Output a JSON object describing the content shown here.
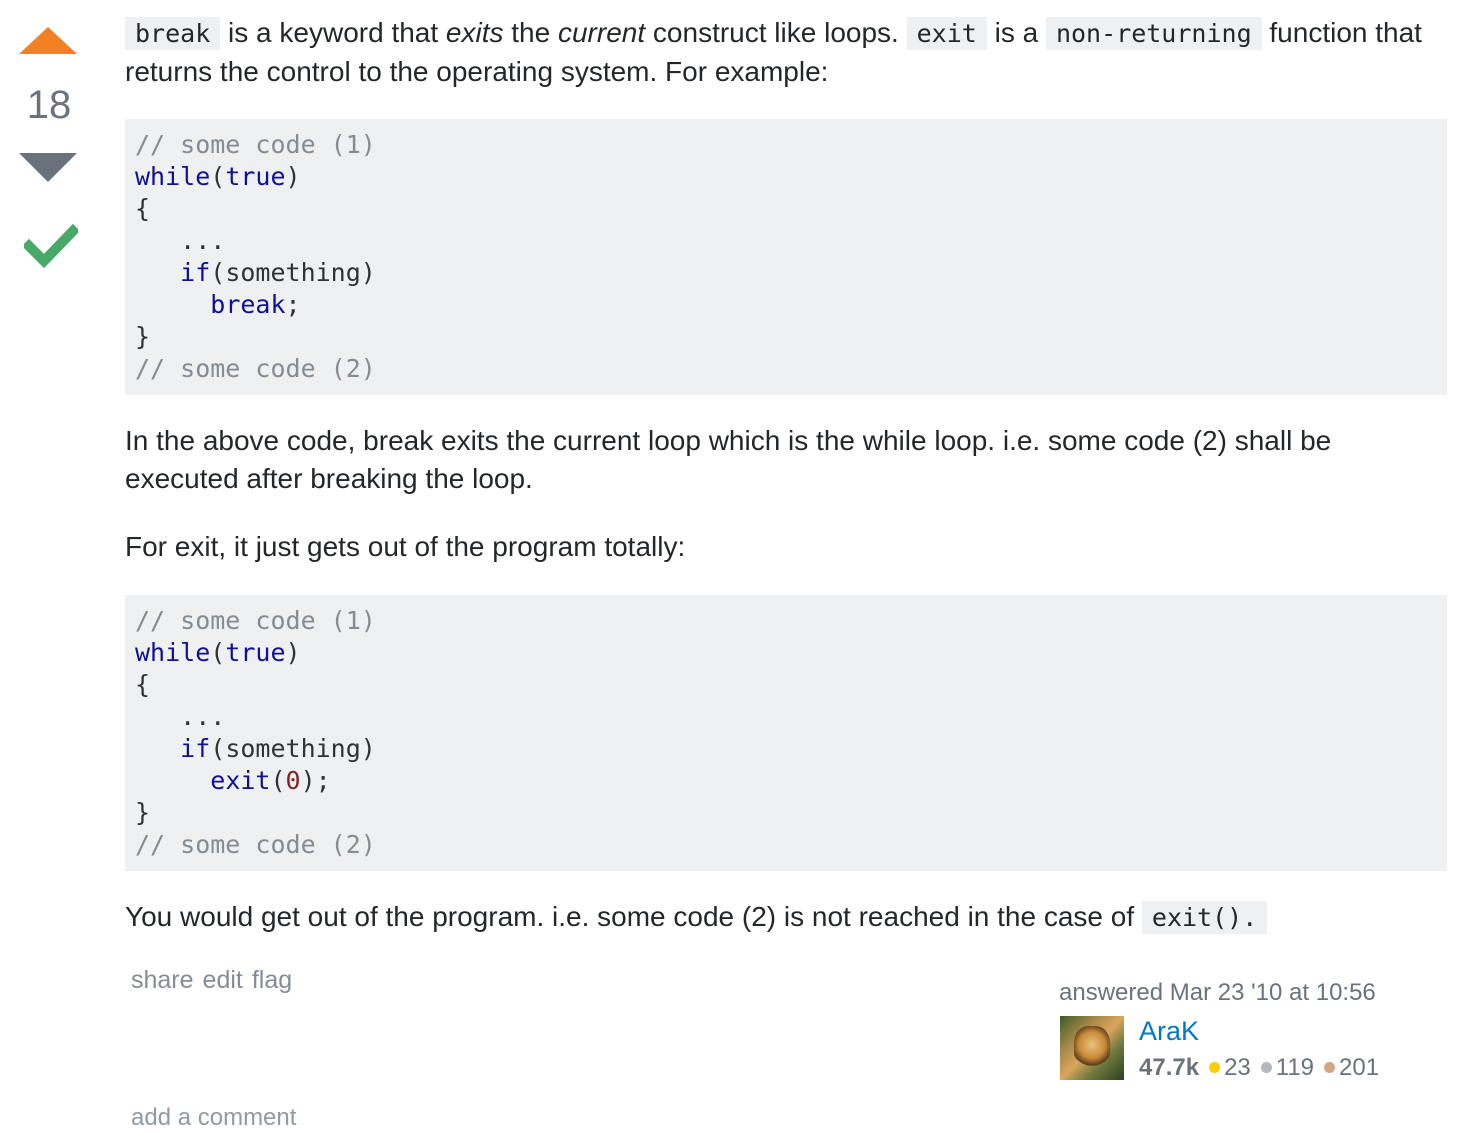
{
  "vote": {
    "count": "18"
  },
  "intro": {
    "code_break": "break",
    "t1": " is a keyword that ",
    "em_exits": "exits",
    "t2": " the ",
    "em_current": "current",
    "t3": " construct like loops. ",
    "code_exit": "exit",
    "t4": " is a ",
    "code_nonreturning": "non-returning",
    "t5": " function that returns the control to the operating system. For example:"
  },
  "code1": {
    "l1": "// some code (1)",
    "l2_kw": "while",
    "l2_p1": "(",
    "l2_kw2": "true",
    "l2_p2": ")",
    "l3": "{",
    "l4": "   ...",
    "l5_indent": "   ",
    "l5_kw": "if",
    "l5_rest": "(something)",
    "l6_indent": "     ",
    "l6_kw": "break",
    "l6_rest": ";",
    "l7": "}",
    "l8": "// some code (2)"
  },
  "para2": "In the above code, break exits the current loop which is the while loop. i.e. some code (2) shall be executed after breaking the loop.",
  "para3": "For exit, it just gets out of the program totally:",
  "code2": {
    "l1": "// some code (1)",
    "l2_kw": "while",
    "l2_p1": "(",
    "l2_kw2": "true",
    "l2_p2": ")",
    "l3": "{",
    "l4": "   ...",
    "l5_indent": "   ",
    "l5_kw": "if",
    "l5_rest": "(something)",
    "l6_indent": "     ",
    "l6_kw": "exit",
    "l6_p1": "(",
    "l6_num": "0",
    "l6_rest": ");",
    "l7": "}",
    "l8": "// some code (2)"
  },
  "para4": {
    "text": "You would get out of the program. i.e. some code (2) is not reached in the case of ",
    "code": "exit()."
  },
  "menu": {
    "share": "share",
    "edit": "edit",
    "flag": "flag"
  },
  "signature": {
    "action": "answered Mar 23 '10 at 10:56",
    "user": "AraK",
    "reputation": "47.7k",
    "gold": "23",
    "silver": "119",
    "bronze": "201"
  },
  "comments": {
    "add": "add a comment"
  },
  "colors": {
    "upvote": "#f48024",
    "accepted": "#48a868",
    "link": "#0077cc"
  }
}
